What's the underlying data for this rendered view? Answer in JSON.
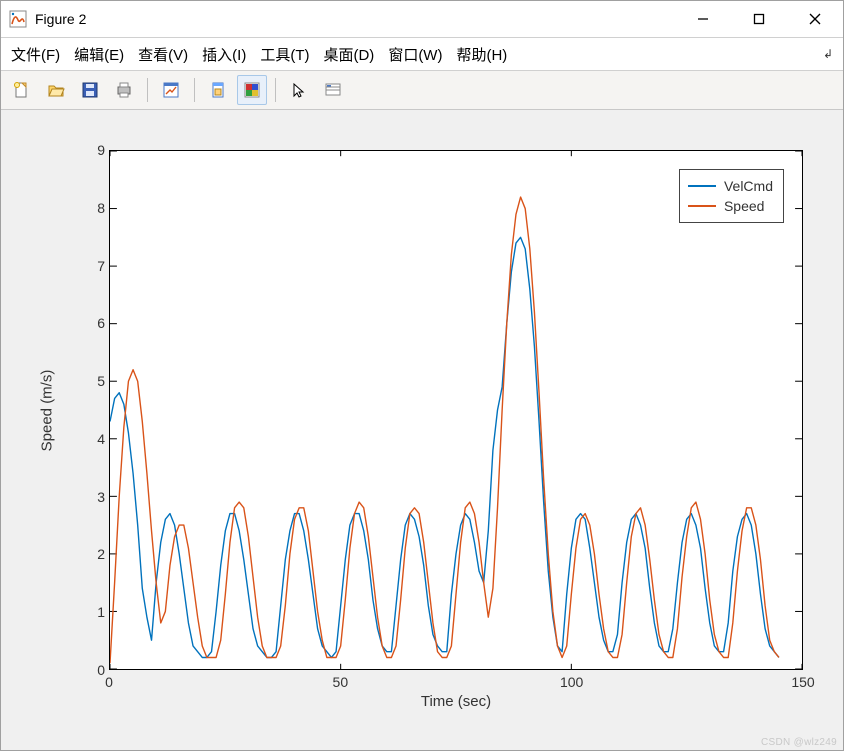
{
  "window": {
    "title": "Figure 2"
  },
  "menus": {
    "items": [
      "文件(F)",
      "编辑(E)",
      "查看(V)",
      "插入(I)",
      "工具(T)",
      "桌面(D)",
      "窗口(W)",
      "帮助(H)"
    ]
  },
  "toolbar": {
    "icons": [
      "new-file-icon",
      "open-folder-icon",
      "save-icon",
      "print-icon",
      "edit-plot-icon",
      "link-icon",
      "colorbar-icon",
      "legend-icon",
      "arrow-cursor-icon",
      "data-cursor-icon"
    ]
  },
  "legend": {
    "entries": [
      {
        "name": "VelCmd",
        "color": "#0072bd"
      },
      {
        "name": "Speed",
        "color": "#d95319"
      }
    ]
  },
  "axes": {
    "xlabel": "Time (sec)",
    "ylabel": "Speed (m/s)",
    "xlim": [
      0,
      150
    ],
    "ylim": [
      0,
      9
    ],
    "xticks": [
      0,
      50,
      100,
      150
    ],
    "yticks": [
      0,
      1,
      2,
      3,
      4,
      5,
      6,
      7,
      8,
      9
    ]
  },
  "watermark": "CSDN @wlz249",
  "chart_data": {
    "type": "line",
    "title": "",
    "xlabel": "Time (sec)",
    "ylabel": "Speed (m/s)",
    "xlim": [
      0,
      150
    ],
    "ylim": [
      0,
      9
    ],
    "x": [
      0,
      1,
      2,
      3,
      4,
      5,
      6,
      7,
      8,
      9,
      10,
      11,
      12,
      13,
      14,
      15,
      16,
      17,
      18,
      19,
      20,
      21,
      22,
      23,
      24,
      25,
      26,
      27,
      28,
      29,
      30,
      31,
      32,
      33,
      34,
      35,
      36,
      37,
      38,
      39,
      40,
      41,
      42,
      43,
      44,
      45,
      46,
      47,
      48,
      49,
      50,
      51,
      52,
      53,
      54,
      55,
      56,
      57,
      58,
      59,
      60,
      61,
      62,
      63,
      64,
      65,
      66,
      67,
      68,
      69,
      70,
      71,
      72,
      73,
      74,
      75,
      76,
      77,
      78,
      79,
      80,
      81,
      82,
      83,
      84,
      85,
      86,
      87,
      88,
      89,
      90,
      91,
      92,
      93,
      94,
      95,
      96,
      97,
      98,
      99,
      100,
      101,
      102,
      103,
      104,
      105,
      106,
      107,
      108,
      109,
      110,
      111,
      112,
      113,
      114,
      115,
      116,
      117,
      118,
      119,
      120,
      121,
      122,
      123,
      124,
      125,
      126,
      127,
      128,
      129,
      130,
      131,
      132,
      133,
      134,
      135,
      136,
      137,
      138,
      139,
      140,
      141,
      142,
      143,
      144,
      145
    ],
    "series": [
      {
        "name": "VelCmd",
        "color": "#0072bd",
        "values": [
          4.3,
          4.7,
          4.8,
          4.6,
          4.1,
          3.4,
          2.5,
          1.4,
          0.9,
          0.5,
          1.5,
          2.2,
          2.6,
          2.7,
          2.5,
          2.0,
          1.4,
          0.8,
          0.4,
          0.3,
          0.2,
          0.2,
          0.3,
          1.0,
          1.8,
          2.4,
          2.7,
          2.7,
          2.4,
          1.9,
          1.3,
          0.7,
          0.4,
          0.3,
          0.2,
          0.2,
          0.3,
          1.1,
          1.9,
          2.4,
          2.7,
          2.7,
          2.4,
          1.9,
          1.3,
          0.7,
          0.4,
          0.3,
          0.2,
          0.3,
          1.1,
          1.9,
          2.5,
          2.7,
          2.7,
          2.4,
          1.9,
          1.2,
          0.7,
          0.4,
          0.3,
          0.3,
          1.1,
          1.9,
          2.5,
          2.7,
          2.6,
          2.3,
          1.8,
          1.1,
          0.6,
          0.4,
          0.3,
          0.3,
          1.3,
          2.0,
          2.5,
          2.7,
          2.6,
          2.2,
          1.7,
          1.5,
          2.4,
          3.8,
          4.5,
          4.9,
          6.0,
          6.9,
          7.4,
          7.5,
          7.3,
          6.6,
          5.6,
          4.3,
          2.9,
          1.7,
          0.9,
          0.4,
          0.3,
          1.3,
          2.1,
          2.6,
          2.7,
          2.6,
          2.1,
          1.5,
          0.9,
          0.5,
          0.3,
          0.3,
          0.6,
          1.5,
          2.2,
          2.6,
          2.7,
          2.5,
          2.1,
          1.4,
          0.8,
          0.4,
          0.3,
          0.3,
          0.7,
          1.5,
          2.2,
          2.6,
          2.7,
          2.5,
          2.1,
          1.4,
          0.8,
          0.4,
          0.3,
          0.3,
          0.8,
          1.7,
          2.3,
          2.6,
          2.7,
          2.5,
          2.0,
          1.3,
          0.7,
          0.4,
          0.3,
          0.2
        ]
      },
      {
        "name": "Speed",
        "color": "#d95319",
        "values": [
          0.1,
          1.5,
          3.0,
          4.2,
          5.0,
          5.2,
          5.0,
          4.3,
          3.4,
          2.4,
          1.5,
          0.8,
          1.0,
          1.8,
          2.3,
          2.5,
          2.5,
          2.1,
          1.5,
          0.9,
          0.4,
          0.2,
          0.2,
          0.2,
          0.5,
          1.3,
          2.2,
          2.8,
          2.9,
          2.8,
          2.3,
          1.6,
          0.9,
          0.4,
          0.2,
          0.2,
          0.2,
          0.4,
          1.1,
          2.0,
          2.6,
          2.8,
          2.8,
          2.4,
          1.7,
          1.0,
          0.5,
          0.2,
          0.2,
          0.2,
          0.4,
          1.2,
          2.1,
          2.7,
          2.9,
          2.8,
          2.3,
          1.6,
          0.9,
          0.4,
          0.2,
          0.2,
          0.4,
          1.2,
          2.1,
          2.7,
          2.8,
          2.7,
          2.2,
          1.5,
          0.8,
          0.3,
          0.2,
          0.2,
          0.4,
          1.3,
          2.2,
          2.8,
          2.9,
          2.7,
          2.2,
          1.5,
          0.9,
          1.4,
          2.8,
          4.5,
          6.0,
          7.2,
          7.9,
          8.2,
          8.0,
          7.3,
          6.2,
          4.8,
          3.3,
          2.0,
          1.0,
          0.4,
          0.2,
          0.4,
          1.3,
          2.1,
          2.6,
          2.7,
          2.5,
          2.0,
          1.3,
          0.7,
          0.3,
          0.2,
          0.2,
          0.6,
          1.5,
          2.3,
          2.7,
          2.8,
          2.5,
          1.9,
          1.2,
          0.6,
          0.3,
          0.2,
          0.2,
          0.7,
          1.6,
          2.3,
          2.8,
          2.9,
          2.6,
          2.0,
          1.2,
          0.6,
          0.3,
          0.2,
          0.2,
          0.8,
          1.7,
          2.4,
          2.8,
          2.8,
          2.5,
          1.9,
          1.1,
          0.5,
          0.3,
          0.2
        ]
      }
    ]
  }
}
